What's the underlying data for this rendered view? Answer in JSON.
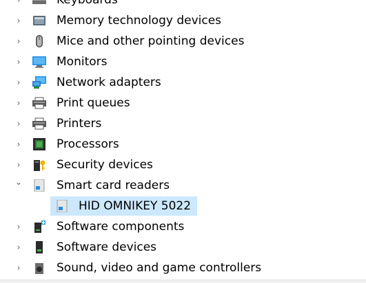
{
  "tree": {
    "items": [
      {
        "label": "Keyboards",
        "icon": "keyboard-icon",
        "state": "collapsed"
      },
      {
        "label": "Memory technology devices",
        "icon": "memory-device-icon",
        "state": "collapsed"
      },
      {
        "label": "Mice and other pointing devices",
        "icon": "mouse-icon",
        "state": "collapsed"
      },
      {
        "label": "Monitors",
        "icon": "monitor-icon",
        "state": "collapsed"
      },
      {
        "label": "Network adapters",
        "icon": "network-adapter-icon",
        "state": "collapsed"
      },
      {
        "label": "Print queues",
        "icon": "print-queue-icon",
        "state": "collapsed"
      },
      {
        "label": "Printers",
        "icon": "printer-icon",
        "state": "collapsed"
      },
      {
        "label": "Processors",
        "icon": "processor-icon",
        "state": "collapsed"
      },
      {
        "label": "Security devices",
        "icon": "security-device-icon",
        "state": "collapsed"
      },
      {
        "label": "Smart card readers",
        "icon": "smart-card-reader-icon",
        "state": "expanded"
      },
      {
        "label": "Software components",
        "icon": "software-component-icon",
        "state": "collapsed"
      },
      {
        "label": "Software devices",
        "icon": "software-device-icon",
        "state": "collapsed"
      },
      {
        "label": "Sound, video and game controllers",
        "icon": "sound-controller-icon",
        "state": "collapsed"
      }
    ],
    "selected_child": {
      "label": "HID OMNIKEY 5022",
      "icon": "smart-card-reader-icon",
      "parent": "Smart card readers"
    }
  },
  "glyphs": {
    "collapsed": "›",
    "expanded": "⌄"
  },
  "colors": {
    "selection": "#cce8ff",
    "monitor_blue": "#1f8fe6",
    "processor_green": "#2e7d32"
  }
}
